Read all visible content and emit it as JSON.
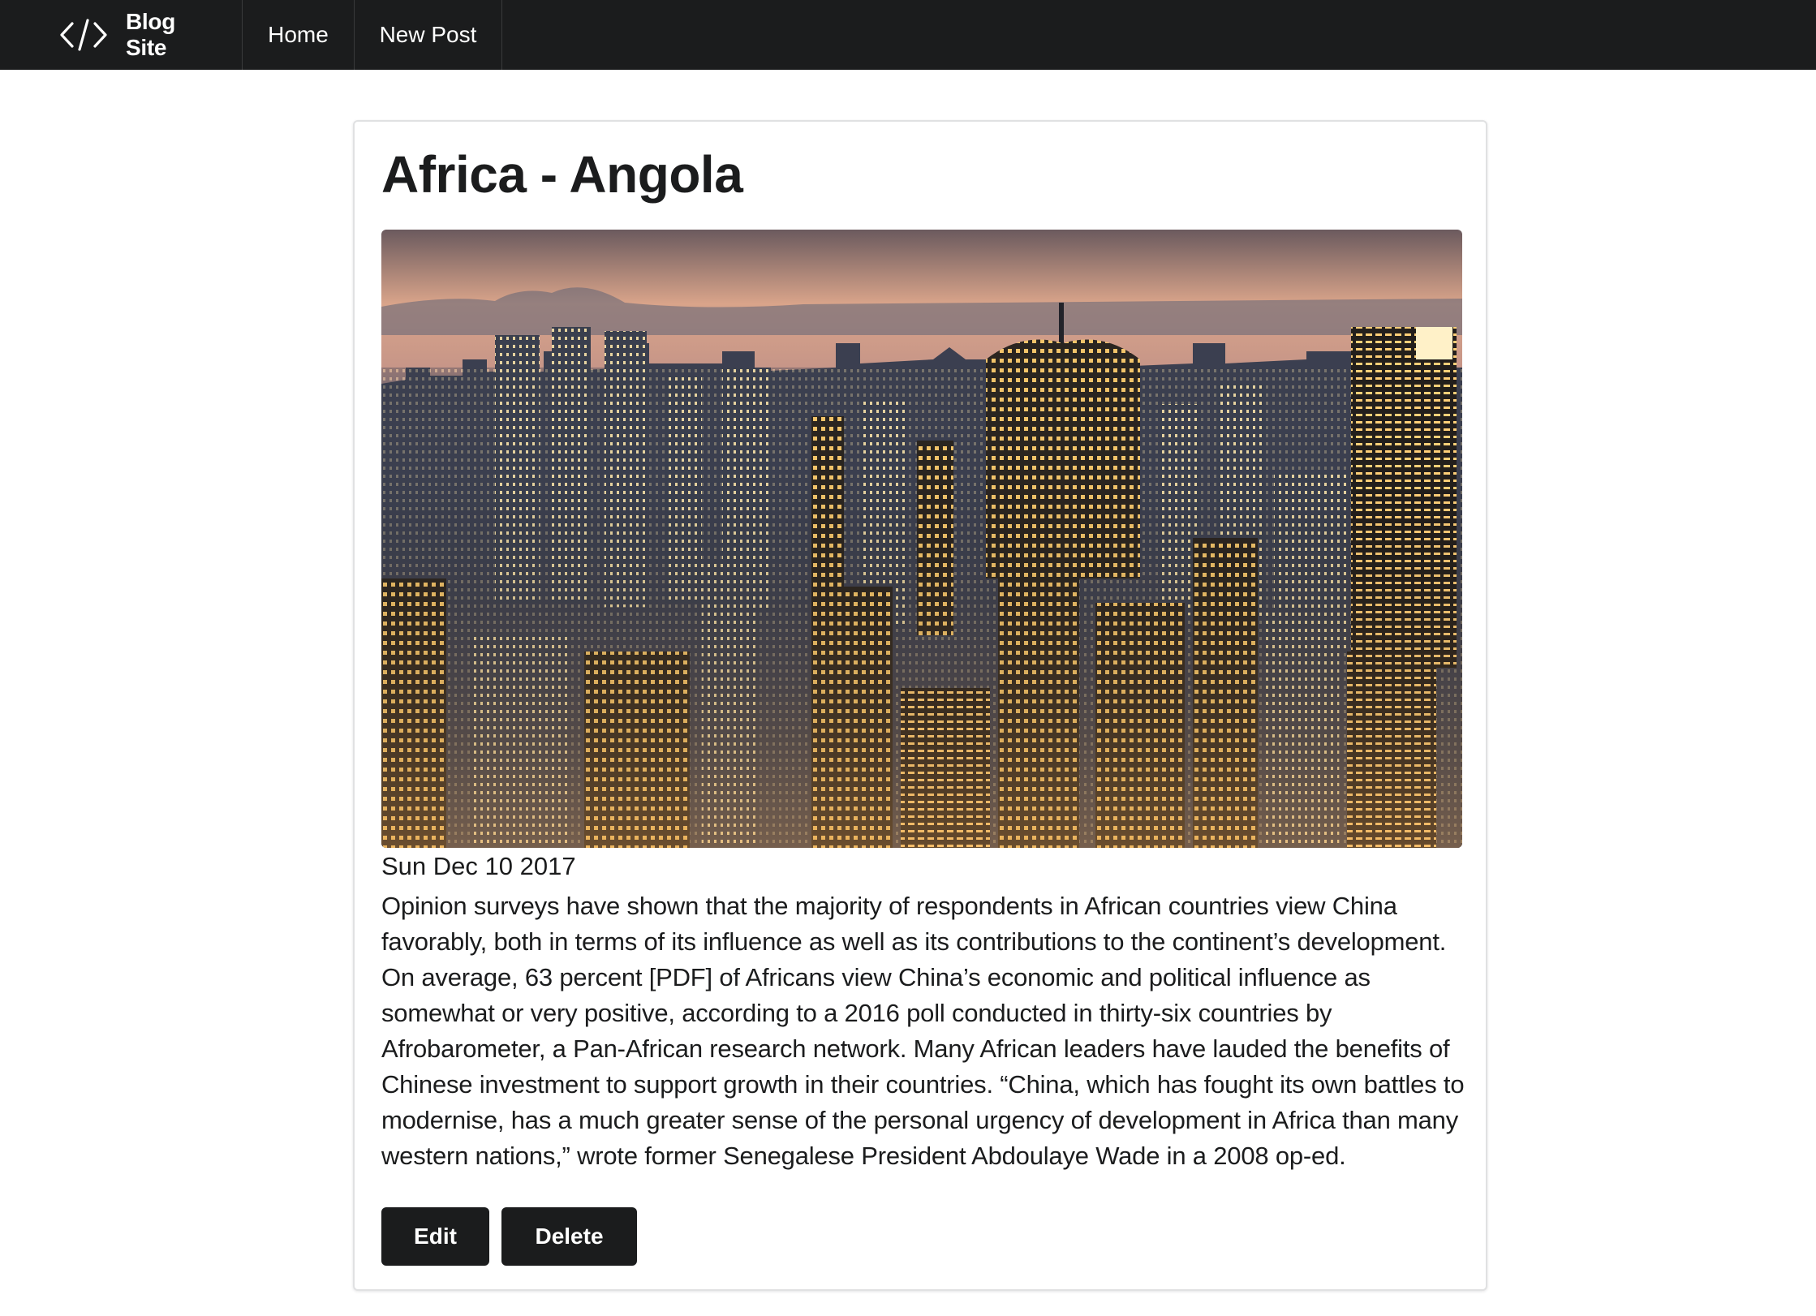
{
  "nav": {
    "brand_label": "Blog Site",
    "brand_icon": "code-icon",
    "items": [
      {
        "label": "Home"
      },
      {
        "label": "New Post"
      }
    ]
  },
  "post": {
    "title": "Africa - Angola",
    "image_alt": "city-skyline-at-dusk",
    "date": "Sun Dec 10 2017",
    "body": "Opinion surveys have shown that the majority of respondents in African countries view China favorably, both in terms of its influence as well as its contributions to the continent’s development. On average, 63 percent [PDF] of Africans view China’s economic and political influence as somewhat or very positive, according to a 2016 poll conducted in thirty-six countries by Afrobarometer, a Pan-African research network. Many African leaders have lauded the benefits of Chinese investment to support growth in their countries. “China, which has fought its own battles to modernise, has a much greater sense of the personal urgency of development in Africa than many western nations,” wrote former Senegalese President Abdoulaye Wade in a 2008 op-ed.",
    "edit_label": "Edit",
    "delete_label": "Delete"
  },
  "colors": {
    "nav_bg": "#1b1c1d",
    "button_bg": "#1b1c1d",
    "text": "#1b1c1d"
  }
}
